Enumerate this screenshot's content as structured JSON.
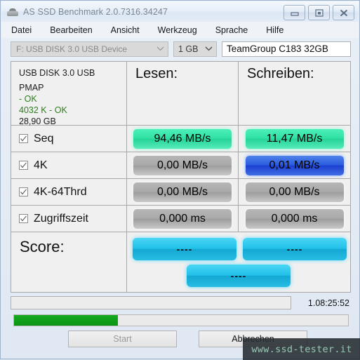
{
  "window": {
    "title": "AS SSD Benchmark 2.0.7316.34247",
    "app_icon": "disk-drive-icon",
    "buttons": {
      "minimize": "minimize-icon",
      "maximize": "restore-icon",
      "close": "close-icon"
    }
  },
  "menu": {
    "items": [
      {
        "label": "Datei"
      },
      {
        "label": "Bearbeiten"
      },
      {
        "label": "Ansicht"
      },
      {
        "label": "Werkzeug"
      },
      {
        "label": "Sprache"
      },
      {
        "label": "Hilfe"
      }
    ]
  },
  "toolbar": {
    "drive": "F: USB DISK 3.0 USB Device",
    "size": "1 GB",
    "device_name": "TeamGroup C183 32GB"
  },
  "info": {
    "model": "USB DISK 3.0 USB",
    "firmware": "PMAP",
    "mode": "- OK",
    "alignment": "4032 K - OK",
    "capacity": "28,90 GB"
  },
  "columns": {
    "read": "Lesen:",
    "write": "Schreiben:"
  },
  "tests": [
    {
      "label": "Seq",
      "checked": true,
      "read": "94,46 MB/s",
      "write": "11,47 MB/s",
      "read_state": "green",
      "write_state": "green"
    },
    {
      "label": "4K",
      "checked": true,
      "read": "0,00 MB/s",
      "write": "0,01 MB/s",
      "read_state": "gray",
      "write_state": "blue"
    },
    {
      "label": "4K-64Thrd",
      "checked": true,
      "read": "0,00 MB/s",
      "write": "0,00 MB/s",
      "read_state": "gray",
      "write_state": "gray"
    },
    {
      "label": "Zugriffszeit",
      "checked": true,
      "read": "0,000 ms",
      "write": "0,000 ms",
      "read_state": "gray",
      "write_state": "gray"
    }
  ],
  "score": {
    "label": "Score:",
    "read": "----",
    "write": "----",
    "total": "----"
  },
  "status": {
    "message": "",
    "elapsed": "1.08:25:52"
  },
  "progress": {
    "percent": 31
  },
  "actions": {
    "start": "Start",
    "cancel": "Abbrechen"
  },
  "watermark": {
    "text": "www.ssd-tester.it"
  },
  "colors": {
    "green_pill": "#2fe0a3",
    "blue_pill": "#2a5ade",
    "gray_pill": "#a9a9a9",
    "score_cyan": "#22c0e8",
    "progress_green": "#0b9414",
    "ok_text": "#2e7d1e"
  }
}
